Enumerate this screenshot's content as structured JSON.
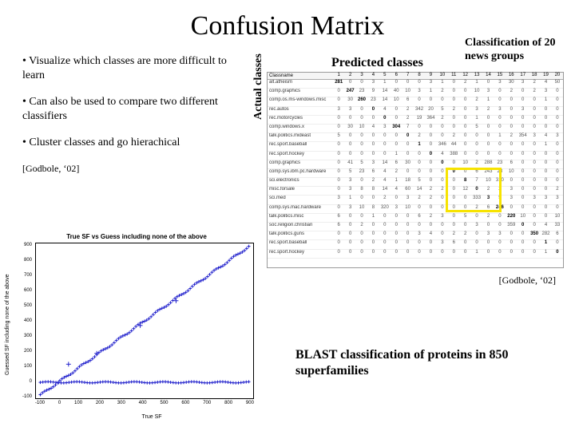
{
  "title": "Confusion Matrix",
  "predicted_label": "Predicted classes",
  "actual_label": "Actual classes",
  "annotation": "Classification of 20 news groups",
  "citation": "[Godbole, ‘02]",
  "bullets": [
    "• Visualize which classes are more difficult to learn",
    "• Can also be used to compare two different classifiers",
    "• Cluster classes and go hierachical"
  ],
  "bullet_cite": "[Godbole, ‘02]",
  "matrix": {
    "col_headers": [
      "1",
      "2",
      "3",
      "4",
      "5",
      "6",
      "7",
      "8",
      "9",
      "10",
      "11",
      "12",
      "13",
      "14",
      "15",
      "16",
      "17",
      "18",
      "19",
      "20"
    ],
    "rows": [
      {
        "label": "alt.atheism",
        "cells": [
          "281",
          "0",
          "0",
          "3",
          "1",
          "0",
          "0",
          "0",
          "3",
          "1",
          "0",
          "2",
          "1",
          "0",
          "3",
          "30",
          "3",
          "2",
          "4",
          "50"
        ]
      },
      {
        "label": "comp.graphics",
        "cells": [
          "0",
          "247",
          "23",
          "9",
          "14",
          "40",
          "10",
          "3",
          "1",
          "2",
          "0",
          "0",
          "10",
          "3",
          "0",
          "2",
          "0",
          "2",
          "3",
          "0"
        ]
      },
      {
        "label": "comp.os.ms-windows.misc",
        "cells": [
          "0",
          "30",
          "260",
          "23",
          "14",
          "10",
          "6",
          "0",
          "0",
          "0",
          "0",
          "0",
          "2",
          "1",
          "0",
          "0",
          "0",
          "0",
          "1",
          "0"
        ]
      },
      {
        "label": "rec.autos",
        "cells": [
          "3",
          "3",
          "0",
          "0",
          "4",
          "0",
          "2",
          "342",
          "20",
          "5",
          "2",
          "0",
          "3",
          "2",
          "3",
          "0",
          "3",
          "0",
          "0",
          "0"
        ]
      },
      {
        "label": "rec.motorcycles",
        "cells": [
          "0",
          "0",
          "0",
          "0",
          "0",
          "0",
          "2",
          "19",
          "364",
          "2",
          "0",
          "0",
          "1",
          "0",
          "0",
          "0",
          "0",
          "0",
          "0",
          "0"
        ]
      },
      {
        "label": "comp.windows.x",
        "cells": [
          "0",
          "30",
          "10",
          "4",
          "3",
          "304",
          "7",
          "0",
          "0",
          "0",
          "0",
          "0",
          "5",
          "0",
          "0",
          "0",
          "0",
          "0",
          "0",
          "0"
        ]
      },
      {
        "label": "talk.politics.mideast",
        "cells": [
          "5",
          "0",
          "0",
          "0",
          "0",
          "0",
          "0",
          "2",
          "0",
          "0",
          "2",
          "0",
          "0",
          "0",
          "1",
          "2",
          "354",
          "3",
          "4",
          "3"
        ]
      },
      {
        "label": "rec.sport.baseball",
        "cells": [
          "0",
          "0",
          "0",
          "0",
          "0",
          "0",
          "0",
          "1",
          "0",
          "346",
          "44",
          "0",
          "0",
          "0",
          "0",
          "0",
          "0",
          "0",
          "1",
          "0"
        ]
      },
      {
        "label": "rec.sport.hockey",
        "cells": [
          "0",
          "0",
          "0",
          "0",
          "0",
          "1",
          "0",
          "0",
          "0",
          "4",
          "388",
          "0",
          "0",
          "0",
          "0",
          "0",
          "0",
          "0",
          "0",
          "0"
        ]
      },
      {
        "label": "comp.graphics",
        "cells": [
          "0",
          "41",
          "5",
          "3",
          "14",
          "6",
          "30",
          "0",
          "0",
          "0",
          "0",
          "10",
          "2",
          "288",
          "23",
          "6",
          "0",
          "0",
          "0",
          "0"
        ]
      },
      {
        "label": "comp.sys.ibm.pc.hardware",
        "cells": [
          "0",
          "5",
          "23",
          "6",
          "4",
          "2",
          "0",
          "0",
          "0",
          "0",
          "0",
          "0",
          "6",
          "243",
          "23",
          "10",
          "0",
          "0",
          "0",
          "0"
        ]
      },
      {
        "label": "sci.electronics",
        "cells": [
          "0",
          "3",
          "0",
          "2",
          "4",
          "1",
          "18",
          "5",
          "0",
          "0",
          "0",
          "8",
          "7",
          "10",
          "310",
          "0",
          "0",
          "0",
          "0",
          "0"
        ]
      },
      {
        "label": "misc.forsale",
        "cells": [
          "0",
          "3",
          "8",
          "8",
          "14",
          "4",
          "60",
          "14",
          "2",
          "2",
          "0",
          "12",
          "0",
          "2",
          "2",
          "3",
          "0",
          "0",
          "0",
          "2"
        ]
      },
      {
        "label": "sci.med",
        "cells": [
          "3",
          "1",
          "0",
          "0",
          "2",
          "0",
          "3",
          "2",
          "2",
          "0",
          "0",
          "0",
          "333",
          "3",
          "5",
          "3",
          "0",
          "3",
          "3",
          "3"
        ]
      },
      {
        "label": "comp.sys.mac.hardware",
        "cells": [
          "0",
          "3",
          "10",
          "8",
          "320",
          "3",
          "10",
          "0",
          "0",
          "0",
          "0",
          "0",
          "2",
          "6",
          "246",
          "0",
          "0",
          "0",
          "0",
          "0"
        ]
      },
      {
        "label": "talk.politics.misc",
        "cells": [
          "6",
          "0",
          "0",
          "1",
          "0",
          "0",
          "0",
          "6",
          "2",
          "3",
          "0",
          "5",
          "0",
          "2",
          "0",
          "220",
          "10",
          "0",
          "0",
          "10"
        ]
      },
      {
        "label": "soc.religion.christian",
        "cells": [
          "6",
          "0",
          "2",
          "0",
          "0",
          "0",
          "0",
          "0",
          "0",
          "0",
          "0",
          "0",
          "3",
          "0",
          "0",
          "359",
          "0",
          "0",
          "4",
          "33"
        ]
      },
      {
        "label": "talk.politics.guns",
        "cells": [
          "0",
          "0",
          "0",
          "0",
          "0",
          "0",
          "0",
          "3",
          "4",
          "0",
          "2",
          "2",
          "0",
          "3",
          "3",
          "0",
          "0",
          "350",
          "282",
          "6"
        ]
      },
      {
        "label": "rec.sport.baseball",
        "cells": [
          "0",
          "0",
          "0",
          "0",
          "0",
          "0",
          "0",
          "0",
          "0",
          "3",
          "6",
          "0",
          "0",
          "0",
          "0",
          "0",
          "0",
          "0",
          "1",
          "0"
        ]
      },
      {
        "label": "rec.sport.hockey",
        "cells": [
          "0",
          "0",
          "0",
          "0",
          "0",
          "0",
          "0",
          "0",
          "0",
          "0",
          "0",
          "0",
          "1",
          "0",
          "0",
          "0",
          "0",
          "0",
          "1",
          "0"
        ]
      }
    ]
  },
  "chart_data": {
    "type": "scatter",
    "title": "True SF vs Guess including none of the above",
    "xlabel": "True SF",
    "ylabel": "Guessed SF including none of the above",
    "xlim": [
      -100,
      900
    ],
    "ylim": [
      -100,
      900
    ],
    "xticks": [
      -100,
      0,
      100,
      200,
      300,
      400,
      500,
      600,
      700,
      800,
      900
    ],
    "yticks": [
      -100,
      0,
      100,
      200,
      300,
      400,
      500,
      600,
      700,
      800,
      900
    ],
    "note": "Dense diagonal band of blue '+' markers plus horizontal line of outliers near y≈0",
    "diagonal_dense": true,
    "outliers": [
      {
        "x": 180,
        "y": 190
      },
      {
        "x": 380,
        "y": 370
      },
      {
        "x": 545,
        "y": 530
      },
      {
        "x": 50,
        "y": 120
      }
    ]
  },
  "blast_caption": "BLAST classification of proteins in 850 superfamilies"
}
